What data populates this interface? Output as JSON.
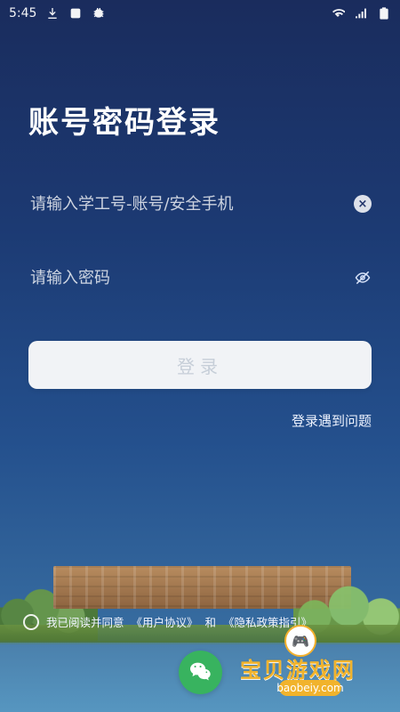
{
  "status_bar": {
    "time": "5:45",
    "left_icons": [
      "download-icon",
      "square-app-icon",
      "bug-icon"
    ],
    "right_icons": [
      "wifi-icon",
      "signal-icon",
      "battery-icon"
    ]
  },
  "page": {
    "title": "账号密码登录"
  },
  "form": {
    "username_placeholder": "请输入学工号-账号/安全手机",
    "password_placeholder": "请输入密码",
    "login_label": "登录",
    "help_label": "登录遇到问题"
  },
  "consent": {
    "prefix": "我已阅读并同意",
    "user_agreement": "《用户协议》",
    "and": "和",
    "privacy": "《隐私政策指引》"
  },
  "bottom": {
    "wechat_icon": "wechat-icon"
  },
  "watermark": {
    "main": "宝贝游戏网",
    "sub": "baobeiy.com"
  },
  "colors": {
    "accent": "#38b35f",
    "button_bg": "#f1f3f6",
    "button_text": "#c6ced8",
    "title_text": "#ffffff"
  }
}
